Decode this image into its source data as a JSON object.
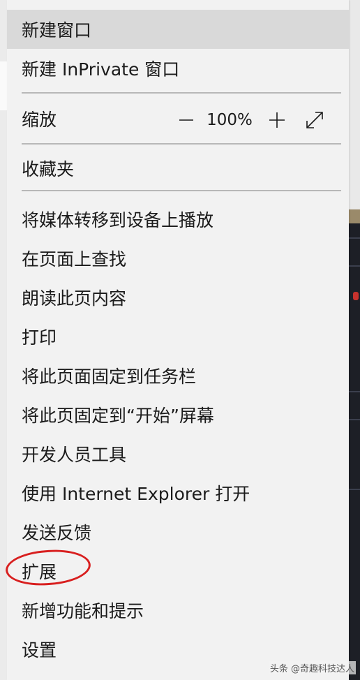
{
  "menu": {
    "items": [
      {
        "label": "新建窗口"
      },
      {
        "label": "新建 InPrivate 窗口"
      },
      {
        "label": "收藏夹"
      },
      {
        "label": "将媒体转移到设备上播放"
      },
      {
        "label": "在页面上查找"
      },
      {
        "label": "朗读此页内容"
      },
      {
        "label": "打印"
      },
      {
        "label": "将此页面固定到任务栏"
      },
      {
        "label": "将此页固定到“开始”屏幕"
      },
      {
        "label": "开发人员工具"
      },
      {
        "label": "使用 Internet Explorer 打开"
      },
      {
        "label": "发送反馈"
      },
      {
        "label": "扩展"
      },
      {
        "label": "新增功能和提示"
      },
      {
        "label": "设置"
      }
    ],
    "zoom": {
      "label": "缩放",
      "value": "100%",
      "decrease_icon": "minus-icon",
      "increase_icon": "plus-icon",
      "fullscreen_icon": "fullscreen-arrows-icon"
    }
  },
  "annotation": {
    "highlight_color": "#d81f1f",
    "highlighted_item": "扩展"
  },
  "watermark": "头条 @奇趣科技达人",
  "colors": {
    "menu_bg": "#f2f2f2",
    "hover_bg": "#d9d9d9",
    "separator": "#b8b8b8"
  }
}
